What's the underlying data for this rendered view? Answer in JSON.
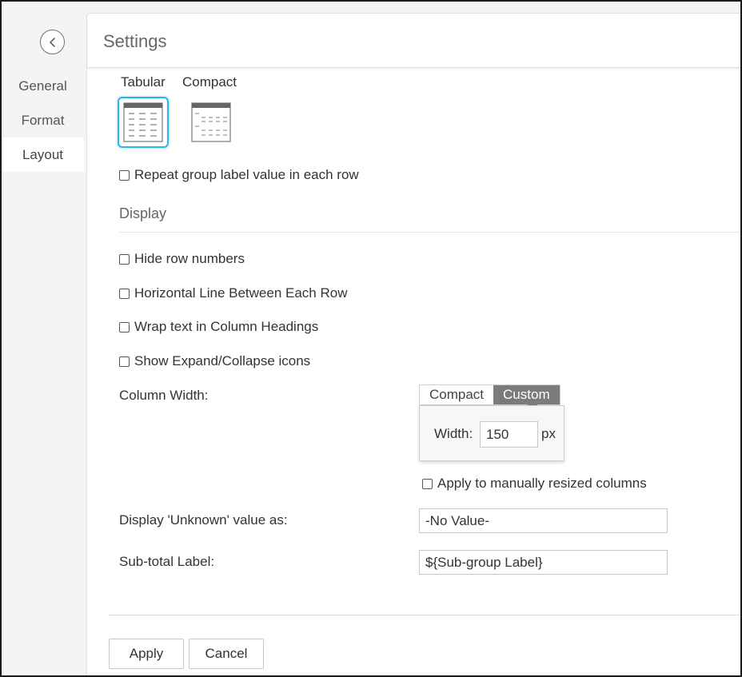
{
  "header": {
    "title": "Settings"
  },
  "sidebar": {
    "items": [
      {
        "label": "General"
      },
      {
        "label": "Format"
      },
      {
        "label": "Layout"
      }
    ],
    "active": "Layout"
  },
  "layout_options": {
    "tabular_label": "Tabular",
    "compact_label": "Compact",
    "selected": "Tabular"
  },
  "repeat_label": "Repeat group label value in each row",
  "display": {
    "title": "Display",
    "options": [
      {
        "label": "Hide row numbers",
        "checked": false
      },
      {
        "label": "Horizontal Line Between Each Row",
        "checked": false
      },
      {
        "label": "Wrap text in Column Headings",
        "checked": false
      },
      {
        "label": "Show Expand/Collapse icons",
        "checked": false
      }
    ]
  },
  "column_width": {
    "label": "Column Width:",
    "compact_label": "Compact",
    "custom_label": "Custom",
    "selected": "Custom",
    "width_label": "Width:",
    "width_value": "150",
    "unit": "px",
    "apply_resized_label": "Apply to manually resized columns"
  },
  "unknown_value": {
    "label": "Display 'Unknown' value as:",
    "value": "-No Value-"
  },
  "subtotal": {
    "label": "Sub-total Label:",
    "value": "${Sub-group Label}"
  },
  "footer": {
    "apply_label": "Apply",
    "cancel_label": "Cancel"
  },
  "colors": {
    "accent": "#29b6e8",
    "segment_active": "#7b7b7b"
  }
}
